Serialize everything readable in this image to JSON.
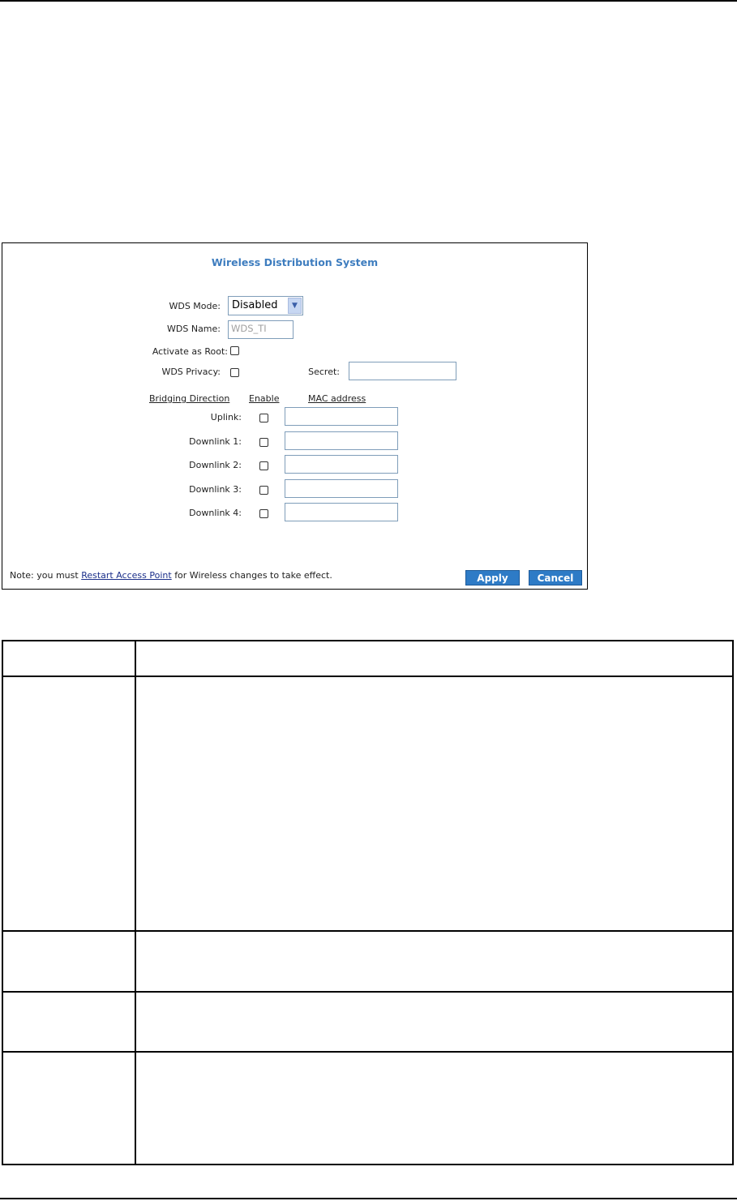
{
  "panel": {
    "title": "Wireless Distribution System",
    "wds_mode_label": "WDS Mode:",
    "wds_mode_value": "Disabled",
    "wds_name_label": "WDS Name:",
    "wds_name_value": "WDS_TI",
    "activate_root_label": "Activate as Root:",
    "wds_privacy_label": "WDS Privacy:",
    "secret_label": "Secret:",
    "secret_value": "",
    "bridging": {
      "col_direction": "Bridging Direction",
      "col_enable": "Enable",
      "col_mac": "MAC address",
      "rows": [
        {
          "label": "Uplink:",
          "mac": ""
        },
        {
          "label": "Downlink 1:",
          "mac": ""
        },
        {
          "label": "Downlink 2:",
          "mac": ""
        },
        {
          "label": "Downlink 3:",
          "mac": ""
        },
        {
          "label": "Downlink 4:",
          "mac": ""
        }
      ]
    },
    "note_prefix": "Note: you must",
    "note_link": "Restart Access Point",
    "note_suffix": "for Wireless changes to take effect.",
    "apply_label": "Apply",
    "cancel_label": "Cancel"
  }
}
